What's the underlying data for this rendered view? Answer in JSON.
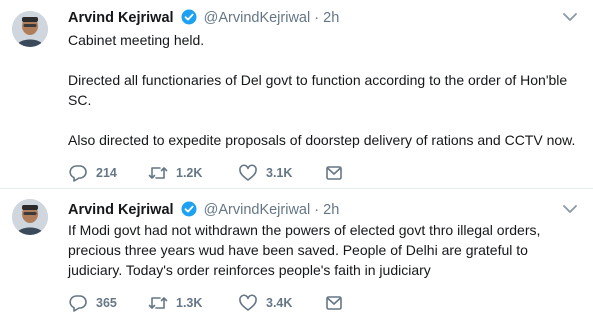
{
  "tweets": [
    {
      "author": {
        "name": "Arvind Kejriwal",
        "handle": "@ArvindKejriwal",
        "separator": "·",
        "time": "2h"
      },
      "paragraphs": [
        "Cabinet meeting held.",
        "Directed all functionaries of Del govt to function according to the order of Hon'ble SC.",
        "Also directed to expedite proposals of doorstep delivery of rations and CCTV now."
      ],
      "stats": {
        "replies": "214",
        "retweets": "1.2K",
        "likes": "3.1K"
      }
    },
    {
      "author": {
        "name": "Arvind Kejriwal",
        "handle": "@ArvindKejriwal",
        "separator": "·",
        "time": "2h"
      },
      "text": "If Modi govt had not withdrawn the powers of elected govt thro illegal orders, precious three years wud have been saved. People of Delhi are grateful to judiciary. Today's order reinforces people's faith in judiciary",
      "stats": {
        "replies": "365",
        "retweets": "1.3K",
        "likes": "3.4K"
      }
    }
  ],
  "colors": {
    "verified": "#1da1f2",
    "muted": "#657786",
    "text": "#14171a",
    "divider": "#e6ecf0"
  },
  "icons": [
    "avatar",
    "verified-badge-icon",
    "caret-down-icon",
    "reply-icon",
    "retweet-icon",
    "like-icon",
    "message-icon"
  ]
}
